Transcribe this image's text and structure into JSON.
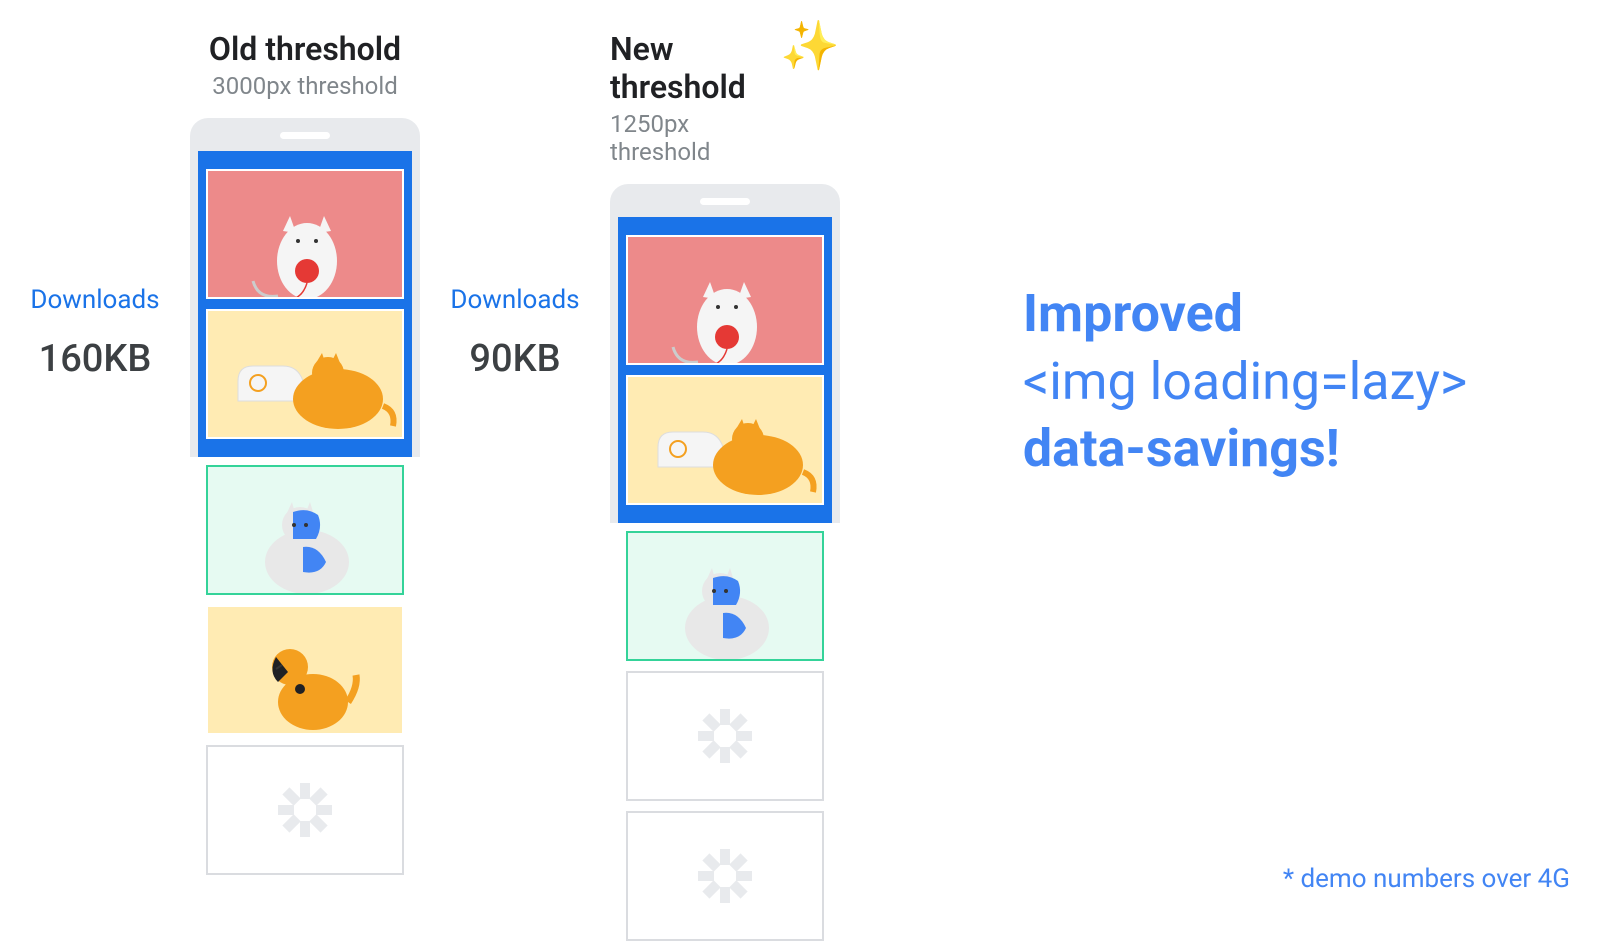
{
  "old": {
    "title": "Old threshold",
    "subtitle": "3000px threshold",
    "downloads_label": "Downloads",
    "downloads_value": "160KB"
  },
  "new": {
    "title": "New threshold",
    "subtitle": "1250px threshold",
    "downloads_label": "Downloads",
    "downloads_value": "90KB"
  },
  "marketing": {
    "line1": "Improved",
    "line2": "<img loading=lazy>",
    "line3": "data-savings!"
  },
  "footnote": "* demo numbers over 4G",
  "icons": {
    "sparkle": "✨"
  }
}
